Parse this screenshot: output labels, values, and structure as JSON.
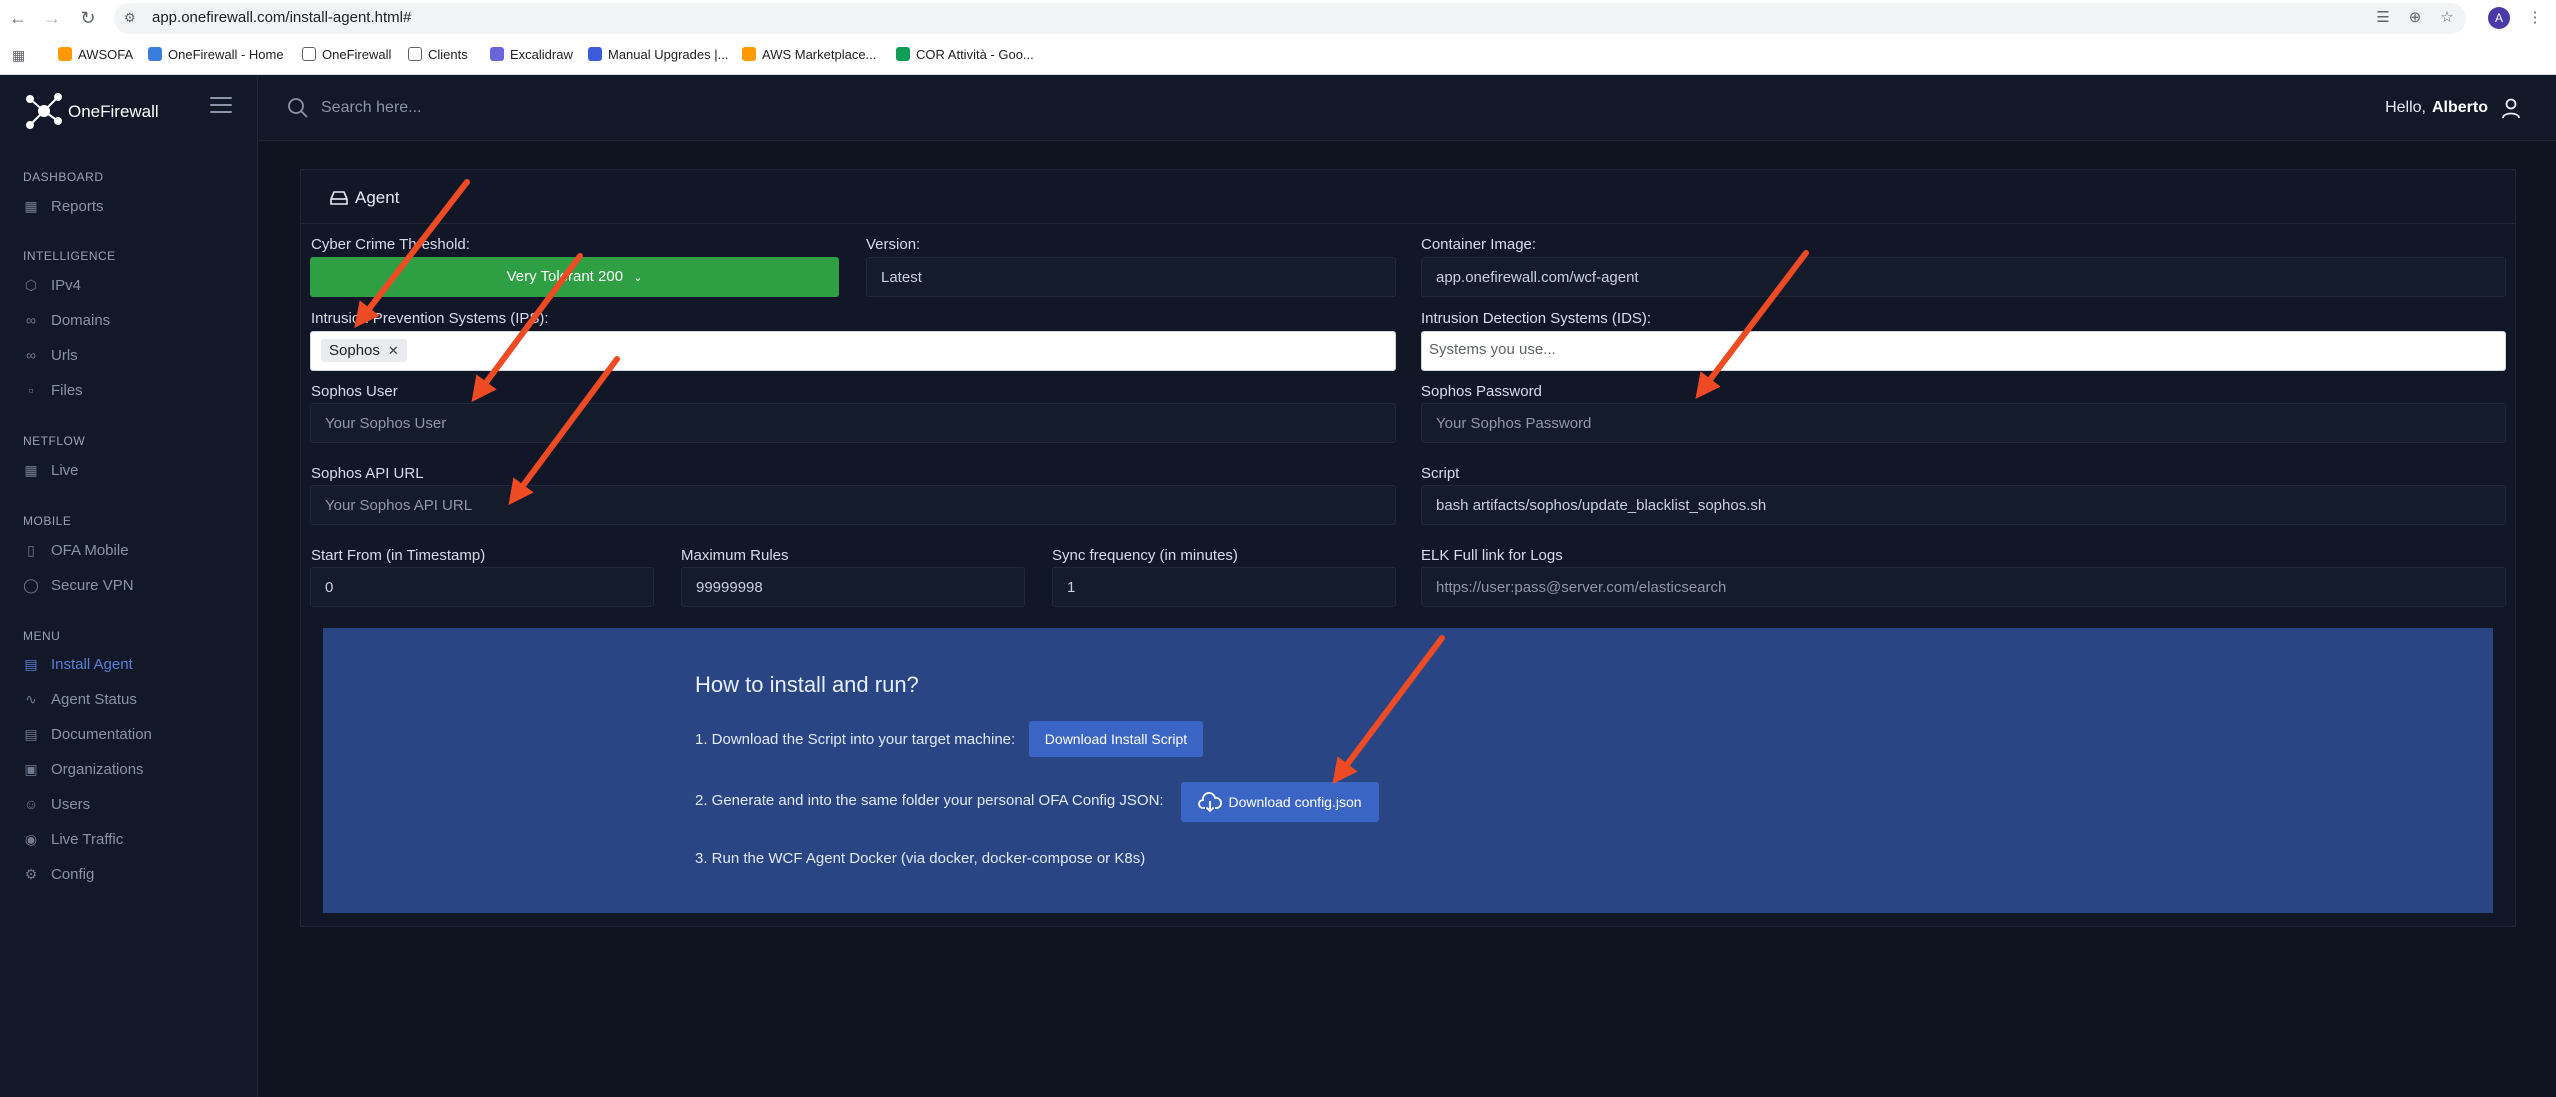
{
  "browser": {
    "url": "app.onefirewall.com/install-agent.html#",
    "profile_initial": "A",
    "bookmarks": [
      {
        "label": "AWSOFA",
        "color": "#ff9900"
      },
      {
        "label": "OneFirewall - Home",
        "color": "#3b7ddd"
      },
      {
        "label": "OneFirewall",
        "color": "#5f6368"
      },
      {
        "label": "Clients",
        "color": "#5f6368"
      },
      {
        "label": "Excalidraw",
        "color": "#6965db"
      },
      {
        "label": "Manual Upgrades |...",
        "color": "#3b5bdb"
      },
      {
        "label": "AWS Marketplace...",
        "color": "#ff9900"
      },
      {
        "label": "COR Attività - Goo...",
        "color": "#0f9d58"
      }
    ]
  },
  "brand": {
    "name": "OneFirewall"
  },
  "sidebar": {
    "sections": [
      {
        "title": "DASHBOARD",
        "items": [
          {
            "label": "Reports",
            "icon": "grid-icon"
          }
        ]
      },
      {
        "title": "INTELLIGENCE",
        "items": [
          {
            "label": "IPv4",
            "icon": "cube-icon"
          },
          {
            "label": "Domains",
            "icon": "link-icon"
          },
          {
            "label": "Urls",
            "icon": "link-icon"
          },
          {
            "label": "Files",
            "icon": "file-icon"
          }
        ]
      },
      {
        "title": "NETFLOW",
        "items": [
          {
            "label": "Live",
            "icon": "grid-icon"
          }
        ]
      },
      {
        "title": "MOBILE",
        "items": [
          {
            "label": "OFA Mobile",
            "icon": "phone-icon"
          },
          {
            "label": "Secure VPN",
            "icon": "shield-icon"
          }
        ]
      },
      {
        "title": "MENU",
        "items": [
          {
            "label": "Install Agent",
            "icon": "drive-icon",
            "active": true
          },
          {
            "label": "Agent Status",
            "icon": "activity-icon"
          },
          {
            "label": "Documentation",
            "icon": "document-icon"
          },
          {
            "label": "Organizations",
            "icon": "briefcase-icon"
          },
          {
            "label": "Users",
            "icon": "users-icon"
          },
          {
            "label": "Live Traffic",
            "icon": "globe-icon"
          },
          {
            "label": "Config",
            "icon": "gear-icon"
          }
        ]
      }
    ]
  },
  "topbar": {
    "search_placeholder": "Search here...",
    "greeting": "Hello,",
    "user_name": "Alberto"
  },
  "agent": {
    "title": "Agent",
    "cyber_crime_label": "Cyber Crime Threshold:",
    "cyber_crime_value": "Very Tolerant 200",
    "version_label": "Version:",
    "version_value": "Latest",
    "container_label": "Container Image:",
    "container_value": "app.onefirewall.com/wcf-agent",
    "ips_label": "Intrusion Prevention Systems (IPS):",
    "ips_chip": "Sophos",
    "ids_label": "Intrusion Detection Systems (IDS):",
    "ids_placeholder": "Systems you use...",
    "sophos_user_label": "Sophos User",
    "sophos_user_placeholder": "Your Sophos User",
    "sophos_password_label": "Sophos Password",
    "sophos_password_placeholder": "Your Sophos Password",
    "sophos_api_label": "Sophos API URL",
    "sophos_api_placeholder": "Your Sophos API URL",
    "script_label": "Script",
    "script_value": "bash artifacts/sophos/update_blacklist_sophos.sh",
    "start_from_label": "Start From (in Timestamp)",
    "start_from_value": "0",
    "max_rules_label": "Maximum Rules",
    "max_rules_value": "99999998",
    "sync_label": "Sync frequency (in minutes)",
    "sync_value": "1",
    "elk_label": "ELK Full link for Logs",
    "elk_placeholder": "https://user:pass@server.com/elasticsearch"
  },
  "install": {
    "title": "How to install and run?",
    "step1": "1. Download the Script into your target machine:",
    "step1_button": "Download Install Script",
    "step2": "2. Generate and into the same folder your personal OFA Config JSON:",
    "step2_button": "Download config.json",
    "step3": "3. Run the WCF Agent Docker (via docker, docker-compose or K8s)"
  },
  "colors": {
    "threshold_green": "#2ea043",
    "panel_blue": "#2a4584",
    "button_blue": "#3a65c4",
    "active_nav": "#5b7fd6",
    "annotation_arrow": "#ee4a24"
  }
}
